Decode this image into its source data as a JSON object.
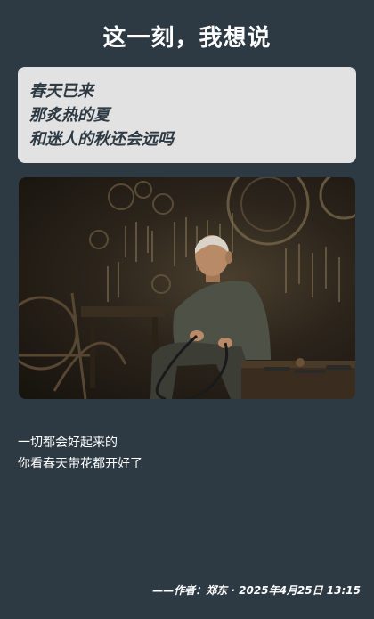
{
  "header": {
    "title": "这一刻，我想说"
  },
  "quote": {
    "lines": [
      "春天已来",
      "那炙热的夏",
      "和迷人的秋还会远吗"
    ]
  },
  "photo": {
    "alt": ""
  },
  "body": {
    "lines": [
      "一切都会好起来的",
      "你看春天带花都开好了"
    ]
  },
  "footer": {
    "byline": "——作者：郑东 · 2025年4月25日 13:15"
  },
  "colors": {
    "background": "#2d3a44",
    "card": "#e2e2e2",
    "card_text": "#2d3a44",
    "text": "#ffffff"
  }
}
